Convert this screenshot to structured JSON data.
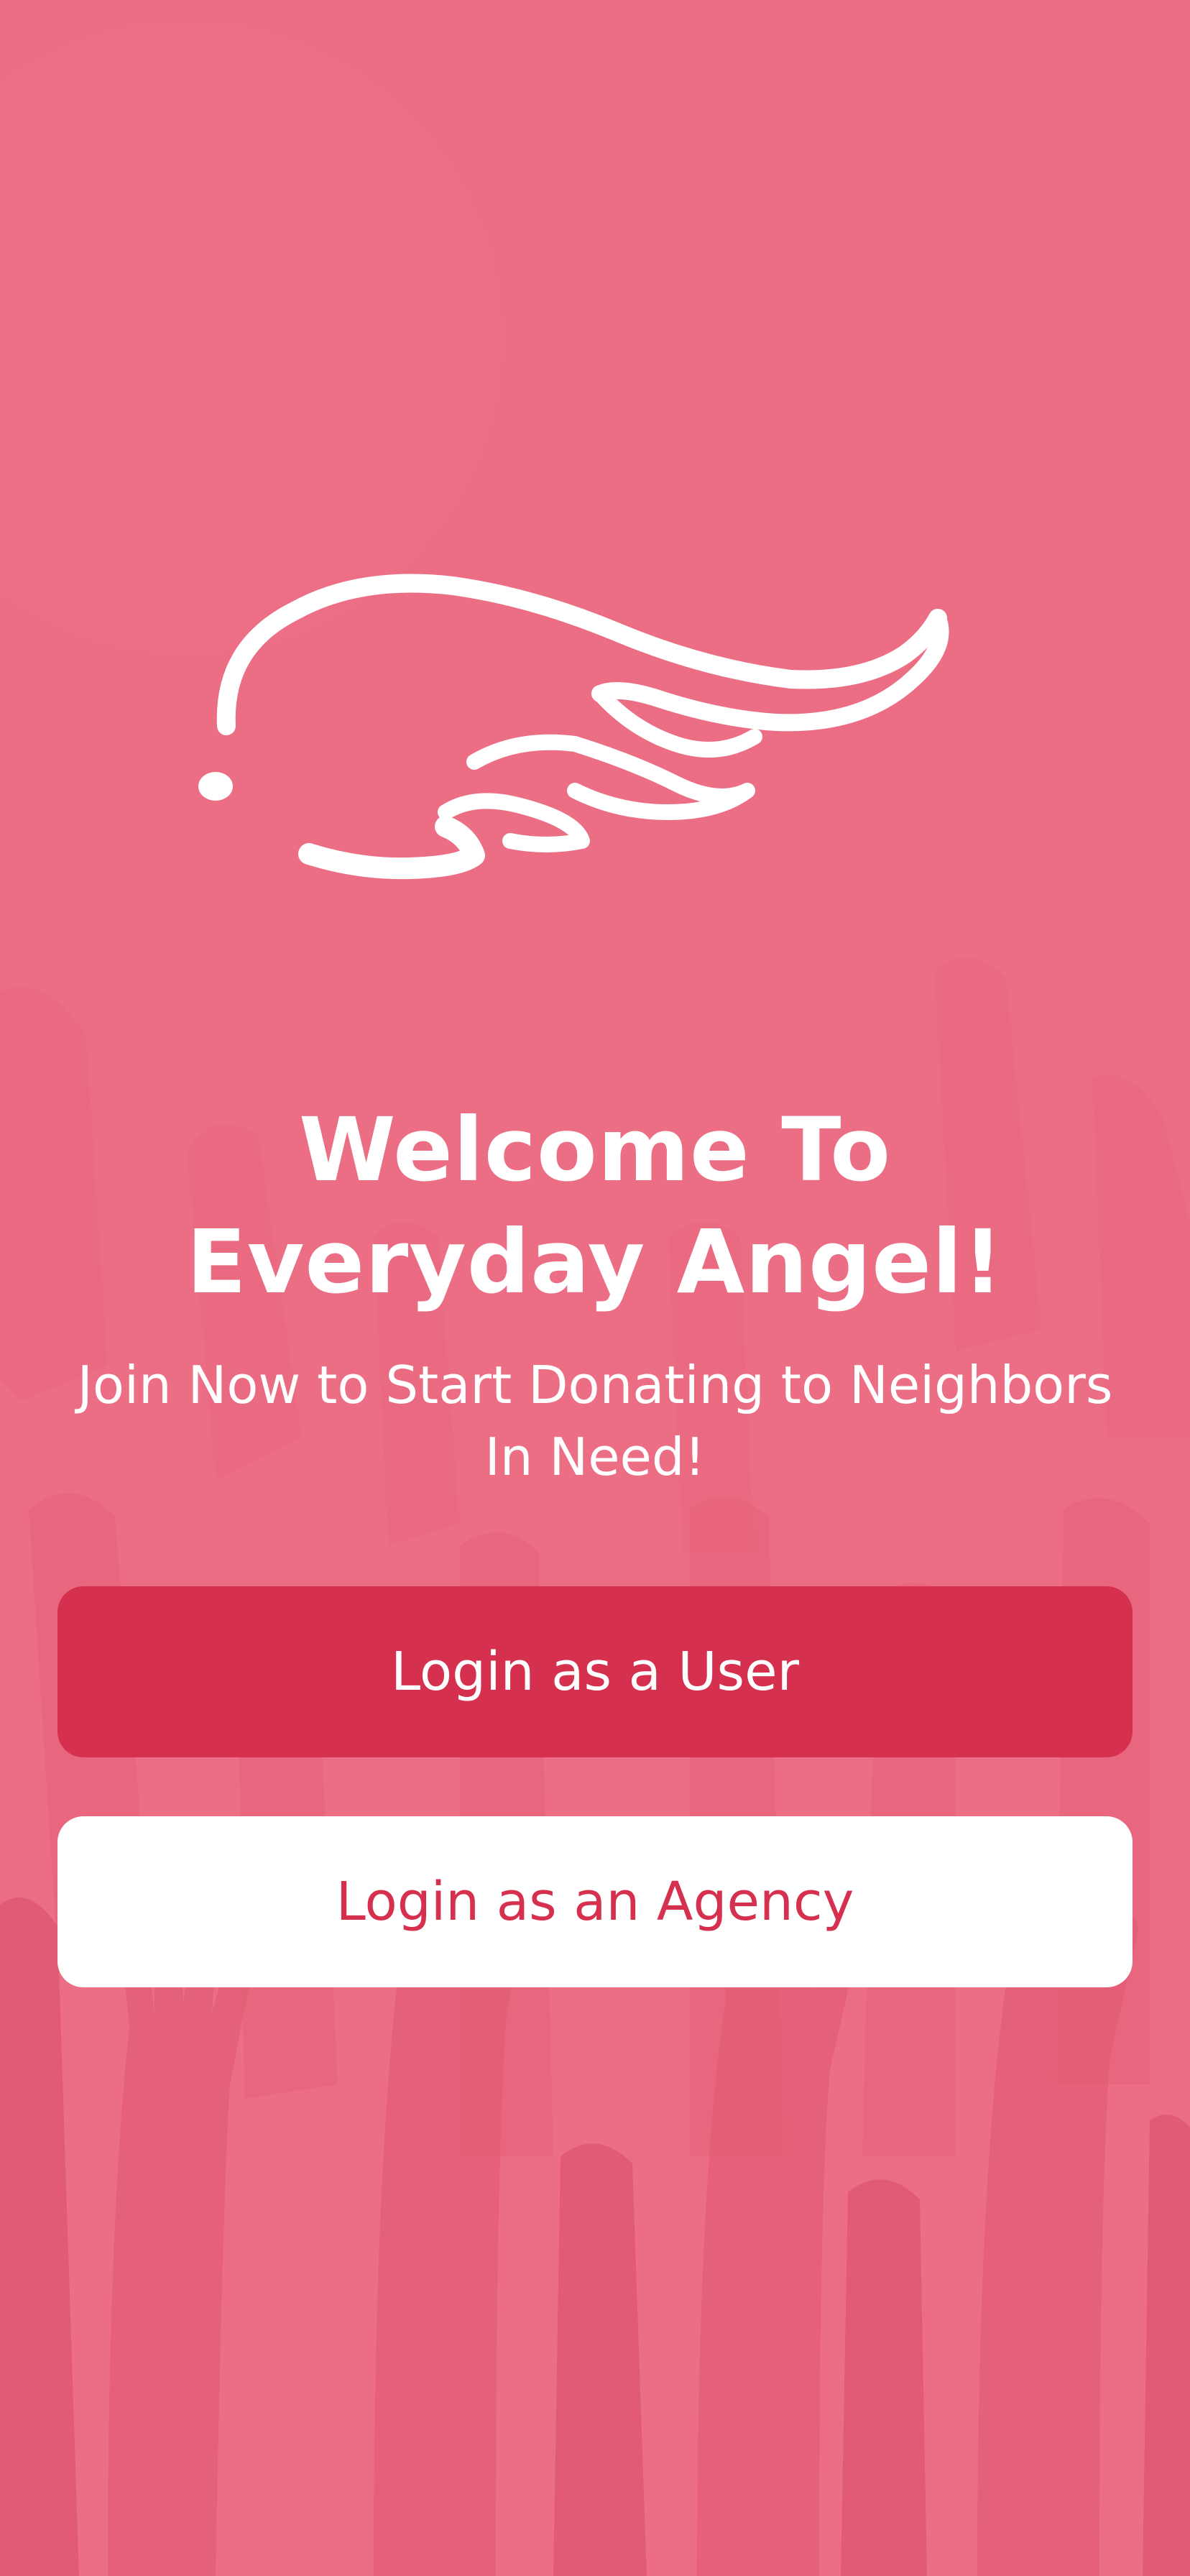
{
  "app": {
    "name": "Everyday Angel"
  },
  "welcome": {
    "title_line1": "Welcome To",
    "title_line2": "Everyday Angel!",
    "subtitle": "Join Now to Start Donating to Neighbors In Need!"
  },
  "buttons": {
    "user_login_label": "Login as a User",
    "agency_login_label": "Login as an Agency"
  },
  "colors": {
    "background": "#EC6E85",
    "accent": "#D6304F",
    "text_on_accent": "#FFFFFF"
  },
  "icons": {
    "logo": "angel-wing-icon",
    "background": "raised-hands-illustration"
  }
}
